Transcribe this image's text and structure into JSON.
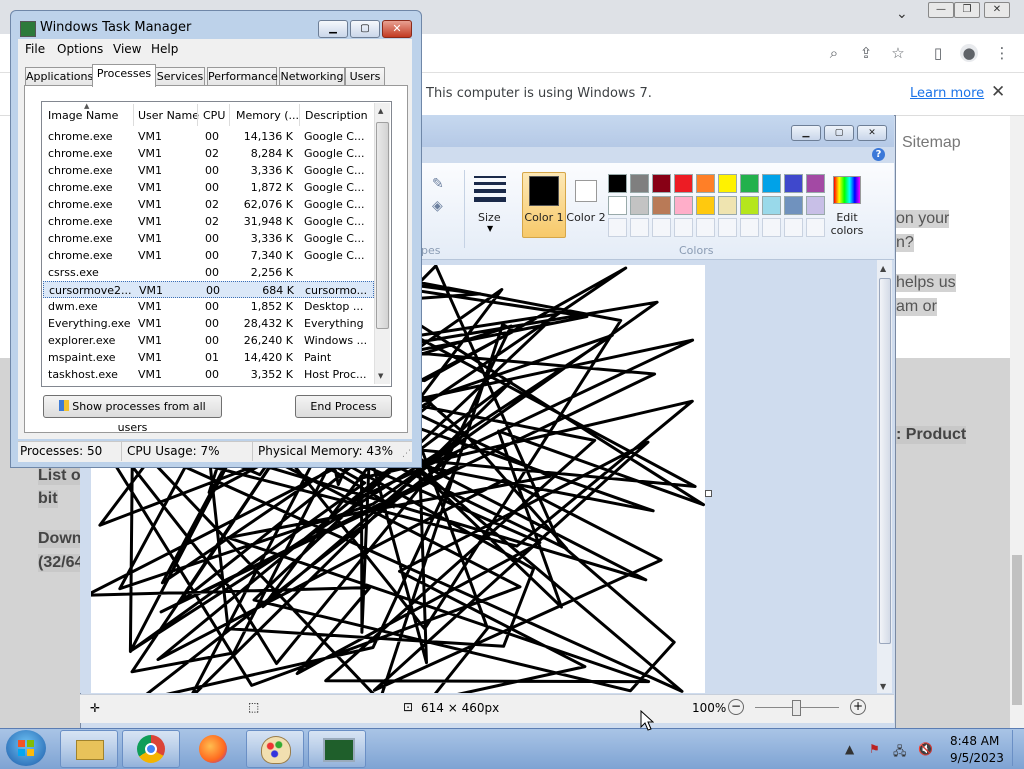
{
  "browser": {
    "infobar_text": "This computer is using Windows 7.",
    "infobar_link": "Learn more",
    "infobar_close": "✕",
    "page_fragments": {
      "sitemap": "Sitemap",
      "frag1": "on your",
      "frag2": "n?",
      "frag3": "helps us",
      "frag4": "am or",
      "frag_product": ": Product",
      "frag_list": "List o",
      "frag_bit": "bit",
      "frag_down": "Down",
      "frag_3264": "(32/64"
    },
    "icons": [
      "search-icon",
      "share-icon",
      "star-icon",
      "sidepanel-icon",
      "profile-icon",
      "menu-icon"
    ]
  },
  "paint": {
    "ribbon": {
      "size_label": "Size",
      "color1_label": "Color 1",
      "color2_label": "Color 2",
      "colors_group": "Colors",
      "edit_colors_label": "Edit colors",
      "shapes_group_fragment": "pes",
      "palette_row1": [
        "#000000",
        "#7f7f7f",
        "#880015",
        "#ed1c24",
        "#ff7f27",
        "#fff200",
        "#22b14c",
        "#00a2e8",
        "#3f48cc",
        "#a349a4"
      ],
      "palette_row2": [
        "#ffffff",
        "#c3c3c3",
        "#b97a57",
        "#ffaec9",
        "#ffc90e",
        "#efe4b0",
        "#b5e61d",
        "#99d9ea",
        "#7092be",
        "#c8bfe7"
      ]
    },
    "statusbar": {
      "size": "614 × 460px",
      "zoom": "100%"
    }
  },
  "taskmanager": {
    "title": "Windows Task Manager",
    "menu": [
      "File",
      "Options",
      "View",
      "Help"
    ],
    "tabs": [
      "Applications",
      "Processes",
      "Services",
      "Performance",
      "Networking",
      "Users"
    ],
    "active_tab": "Processes",
    "columns": [
      "Image Name",
      "User Name",
      "CPU",
      "Memory (...",
      "Description"
    ],
    "rows": [
      {
        "name": "chrome.exe",
        "user": "VM1",
        "cpu": "00",
        "mem": "14,136 K",
        "desc": "Google C..."
      },
      {
        "name": "chrome.exe",
        "user": "VM1",
        "cpu": "02",
        "mem": "8,284 K",
        "desc": "Google C..."
      },
      {
        "name": "chrome.exe",
        "user": "VM1",
        "cpu": "00",
        "mem": "3,336 K",
        "desc": "Google C..."
      },
      {
        "name": "chrome.exe",
        "user": "VM1",
        "cpu": "00",
        "mem": "1,872 K",
        "desc": "Google C..."
      },
      {
        "name": "chrome.exe",
        "user": "VM1",
        "cpu": "02",
        "mem": "62,076 K",
        "desc": "Google C..."
      },
      {
        "name": "chrome.exe",
        "user": "VM1",
        "cpu": "02",
        "mem": "31,948 K",
        "desc": "Google C..."
      },
      {
        "name": "chrome.exe",
        "user": "VM1",
        "cpu": "00",
        "mem": "3,336 K",
        "desc": "Google C..."
      },
      {
        "name": "chrome.exe",
        "user": "VM1",
        "cpu": "00",
        "mem": "7,340 K",
        "desc": "Google C..."
      },
      {
        "name": "csrss.exe",
        "user": "",
        "cpu": "00",
        "mem": "2,256 K",
        "desc": ""
      },
      {
        "name": "cursormove2....",
        "user": "VM1",
        "cpu": "00",
        "mem": "684 K",
        "desc": "cursormo..."
      },
      {
        "name": "dwm.exe",
        "user": "VM1",
        "cpu": "00",
        "mem": "1,852 K",
        "desc": "Desktop ..."
      },
      {
        "name": "Everything.exe",
        "user": "VM1",
        "cpu": "00",
        "mem": "28,432 K",
        "desc": "Everything"
      },
      {
        "name": "explorer.exe",
        "user": "VM1",
        "cpu": "00",
        "mem": "26,240 K",
        "desc": "Windows ..."
      },
      {
        "name": "mspaint.exe",
        "user": "VM1",
        "cpu": "01",
        "mem": "14,420 K",
        "desc": "Paint"
      },
      {
        "name": "taskhost.exe",
        "user": "VM1",
        "cpu": "00",
        "mem": "3,352 K",
        "desc": "Host Proc..."
      }
    ],
    "selected_row": 9,
    "show_all_button": "Show processes from all users",
    "end_process_button": "End Process",
    "status": {
      "processes": "Processes: 50",
      "cpu": "CPU Usage: 7%",
      "memory": "Physical Memory: 43%"
    }
  },
  "taskbar": {
    "time": "8:48 AM",
    "date": "9/5/2023",
    "pinned": [
      "explorer-icon",
      "chrome-icon",
      "firefox-icon",
      "paint-icon",
      "taskmanager-icon"
    ]
  }
}
